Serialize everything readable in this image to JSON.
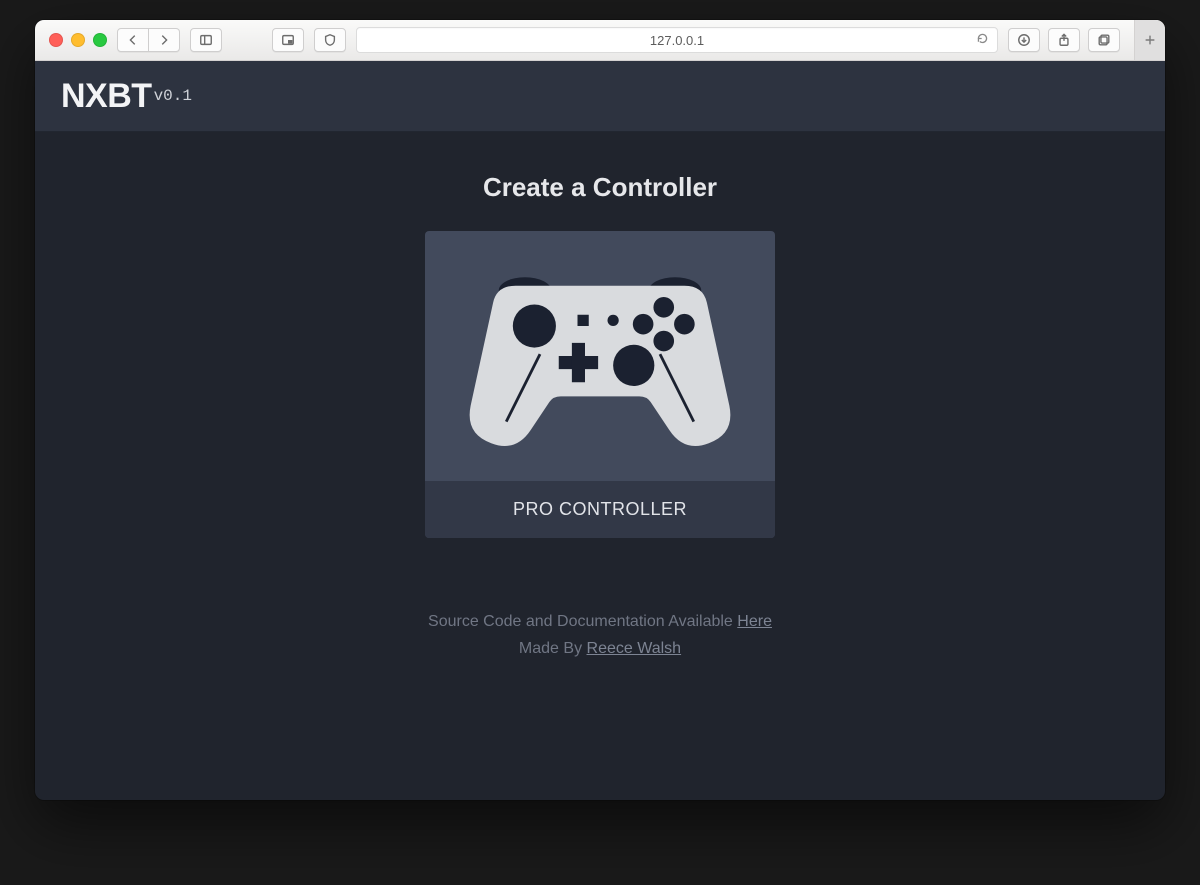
{
  "browser": {
    "url": "127.0.0.1"
  },
  "header": {
    "brand": "NXBT",
    "version": "v0.1"
  },
  "main": {
    "title": "Create a Controller",
    "card_label": "PRO CONTROLLER"
  },
  "footer": {
    "line1_prefix": "Source Code and Documentation Available ",
    "line1_link": "Here",
    "line2_prefix": "Made By ",
    "line2_link": "Reece Walsh"
  }
}
